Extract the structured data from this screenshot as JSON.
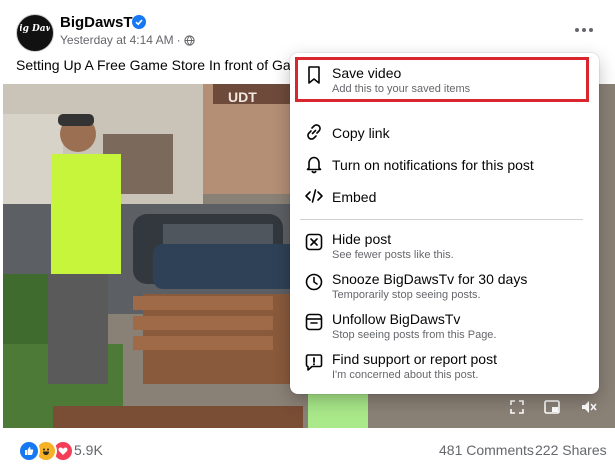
{
  "post": {
    "author": "BigDawsTv",
    "avatar_text": "Big Daws",
    "timestamp": "Yesterday at 4:14 AM",
    "separator": "·",
    "caption": "Setting Up A Free Game Store In front of Gam",
    "video_sign": "UDT",
    "reaction_count": "5.9K",
    "comments": "481 Comments",
    "shares": "222 Shares"
  },
  "menu": {
    "save": {
      "title": "Save video",
      "sub": "Add this to your saved items"
    },
    "copy_link": {
      "title": "Copy link"
    },
    "notifications": {
      "title": "Turn on notifications for this post"
    },
    "embed": {
      "title": "Embed"
    },
    "hide": {
      "title": "Hide post",
      "sub": "See fewer posts like this."
    },
    "snooze": {
      "title": "Snooze BigDawsTv for 30 days",
      "sub": "Temporarily stop seeing posts."
    },
    "unfollow": {
      "title": "Unfollow BigDawsTv",
      "sub": "Stop seeing posts from this Page."
    },
    "report": {
      "title": "Find support or report post",
      "sub": "I'm concerned about this post."
    }
  },
  "colors": {
    "accent": "#1877f2",
    "highlight": "#d9262e",
    "secondary_text": "#65676b"
  },
  "icons": {
    "more": "more-options-icon",
    "verified": "verified-badge-icon",
    "audience": "globe-icon",
    "save": "bookmark-icon",
    "copy_link": "link-icon",
    "notifications": "bell-icon",
    "embed": "code-icon",
    "hide": "hide-x-icon",
    "snooze": "clock-icon",
    "unfollow": "unfollow-icon",
    "report": "report-icon"
  }
}
